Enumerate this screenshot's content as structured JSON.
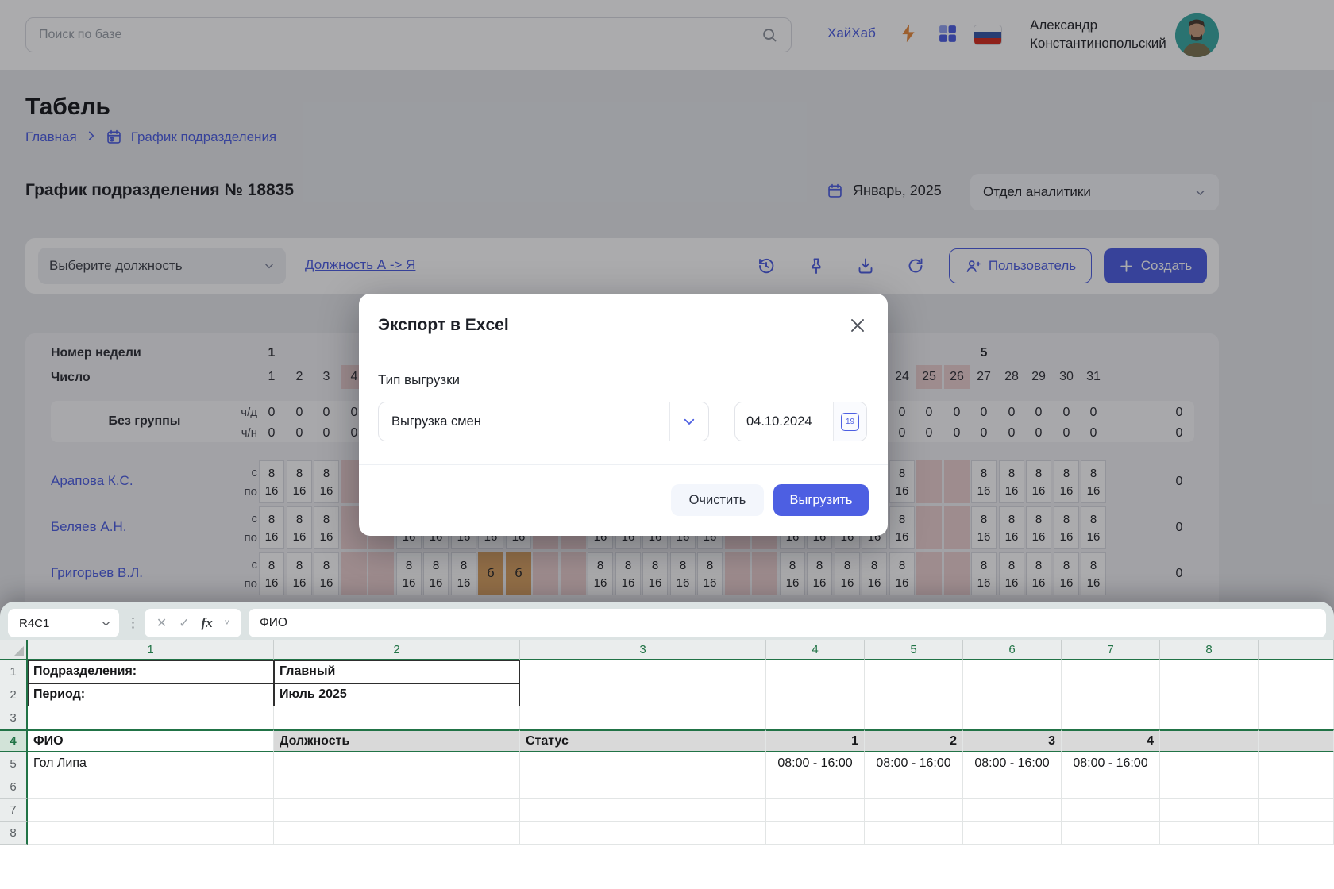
{
  "colors": {
    "accent": "#4d5fe2",
    "excel_green": "#217346",
    "weekend_pink": "#eccfcf",
    "sick_tan": "#d9a263",
    "lightning_orange": "#e98a3c",
    "flag_blue": "#3757a6",
    "flag_red": "#d52b1e"
  },
  "header": {
    "search_placeholder": "Поиск по базе",
    "brand_link": "ХайХаб",
    "user_name_line1": "Александр",
    "user_name_line2": "Константинопольский"
  },
  "page": {
    "title": "Табель",
    "breadcrumb": {
      "home": "Главная",
      "current": "График подразделения"
    },
    "schedule_title": "График подразделения № 18835",
    "period_label": "Январь, 2025",
    "department_value": "Отдел аналитики"
  },
  "toolbar": {
    "position_select_placeholder": "Выберите должность",
    "sort_link": "Должность А -> Я",
    "user_button_label": "Пользователь",
    "create_button_label": "Создать"
  },
  "schedule_table": {
    "week_row_label": "Номер недели",
    "date_row_label": "Число",
    "week_labels": [
      {
        "day": 1,
        "label": "1"
      },
      {
        "day": 27,
        "label": "5"
      }
    ],
    "days_in_month": 31,
    "weekend_days": [
      4,
      5,
      11,
      12,
      18,
      19,
      25,
      26
    ],
    "group_row": {
      "name": "Без группы",
      "per_day_label": "ч/д",
      "per_norm_label": "ч/н",
      "day_value": "0",
      "norm_value": "0",
      "total_day": "0",
      "total_norm": "0"
    },
    "from_label": "с",
    "to_label": "по",
    "sick_label": "б",
    "shift_from": "8",
    "shift_to": "16",
    "employees": [
      {
        "name": "Арапова К.С.",
        "sick_days": [],
        "total": "0"
      },
      {
        "name": "Беляев А.Н.",
        "sick_days": [],
        "total": "0"
      },
      {
        "name": "Григорьев В.Л.",
        "sick_days": [
          9,
          10
        ],
        "total": "0"
      }
    ]
  },
  "modal": {
    "title": "Экспорт в Excel",
    "type_label": "Тип выгрузки",
    "type_value": "Выгрузка смен",
    "date_value": "04.10.2024",
    "date_icon_day": "19",
    "clear_button": "Очистить",
    "export_button": "Выгрузить"
  },
  "spreadsheet": {
    "name_box": "R4C1",
    "fx_label": "fx",
    "formula_value": "ФИО",
    "column_headers": [
      "1",
      "2",
      "3",
      "4",
      "5",
      "6",
      "7",
      "8",
      ""
    ],
    "row_headers": [
      "1",
      "2",
      "3",
      "4",
      "5",
      "6",
      "7",
      "8"
    ],
    "selected_row": 4,
    "active_cell": {
      "row": 4,
      "col": 1
    },
    "cells": [
      {
        "r": 1,
        "c": 1,
        "text": "Подразделения:",
        "bold": true,
        "boxed": true
      },
      {
        "r": 1,
        "c": 2,
        "text": "Главный",
        "bold": true,
        "boxed": true
      },
      {
        "r": 2,
        "c": 1,
        "text": "Период:",
        "bold": true,
        "boxed": true
      },
      {
        "r": 2,
        "c": 2,
        "text": "Июль 2025",
        "bold": true,
        "boxed": true
      },
      {
        "r": 4,
        "c": 1,
        "text": "ФИО",
        "bold": true
      },
      {
        "r": 4,
        "c": 2,
        "text": "Должность",
        "bold": true
      },
      {
        "r": 4,
        "c": 3,
        "text": "Статус",
        "bold": true
      },
      {
        "r": 4,
        "c": 4,
        "text": "1",
        "bold": true,
        "align": "right"
      },
      {
        "r": 4,
        "c": 5,
        "text": "2",
        "bold": true,
        "align": "right"
      },
      {
        "r": 4,
        "c": 6,
        "text": "3",
        "bold": true,
        "align": "right"
      },
      {
        "r": 4,
        "c": 7,
        "text": "4",
        "bold": true,
        "align": "right"
      },
      {
        "r": 5,
        "c": 1,
        "text": "Гол Липа"
      },
      {
        "r": 5,
        "c": 4,
        "text": "08:00 - 16:00",
        "align": "center"
      },
      {
        "r": 5,
        "c": 5,
        "text": "08:00 - 16:00",
        "align": "center"
      },
      {
        "r": 5,
        "c": 6,
        "text": "08:00 - 16:00",
        "align": "center"
      },
      {
        "r": 5,
        "c": 7,
        "text": "08:00 - 16:00",
        "align": "center"
      }
    ]
  }
}
